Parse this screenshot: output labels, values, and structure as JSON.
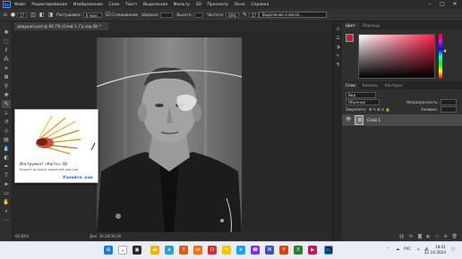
{
  "app": {
    "logo": "Ps",
    "menu": [
      "Файл",
      "Редактирование",
      "Изображение",
      "Слои",
      "Текст",
      "Выделение",
      "Фильтр",
      "3D",
      "Просмотр",
      "Окно",
      "Справка"
    ],
    "window_controls": [
      "–",
      "□",
      "✕"
    ]
  },
  "options": {
    "brush_size": "17",
    "mode_label": "Растушевка:",
    "mode_value": "0 пикс.",
    "antialias_label": "Сглаживание",
    "style_label": "Стиль:",
    "style_value": "Обычный",
    "width_label": "Ширина:",
    "height_label": "Высота:",
    "width_value": "",
    "height_value": "",
    "precision_label": "Частота:",
    "precision_value": "60%",
    "opacity_value": "57",
    "select_label": "Выделение и маска..."
  },
  "document": {
    "tab_title": "дедушка.psd @ 66,7% (Слой 1, Гр.сер./8) *"
  },
  "tooltip": {
    "title": "Инструмент «Кисть» (B)",
    "description": "Рисует штрихи заказной кистью",
    "link": "Узнайте, как"
  },
  "status": {
    "zoom": "66,83%",
    "doc_info": "Док: 39,2К/39,2К"
  },
  "panels": {
    "color_tabs": [
      "Цвет",
      "Образцы"
    ],
    "color_accent": "#e0103a",
    "layers_tabs": [
      "Слои",
      "Каналы",
      "Контуры"
    ],
    "filter_label": "Вид",
    "blend_mode": "Обычные",
    "opacity_label": "Непрозрачность:",
    "opacity_value": "",
    "lock_label": "Закрепить:",
    "fill_label": "Заливка:",
    "fill_value": "",
    "layer_name": "Слой 1"
  },
  "taskbar": {
    "lang": "РУС",
    "time": "18:41",
    "date": "22.10.2024"
  }
}
